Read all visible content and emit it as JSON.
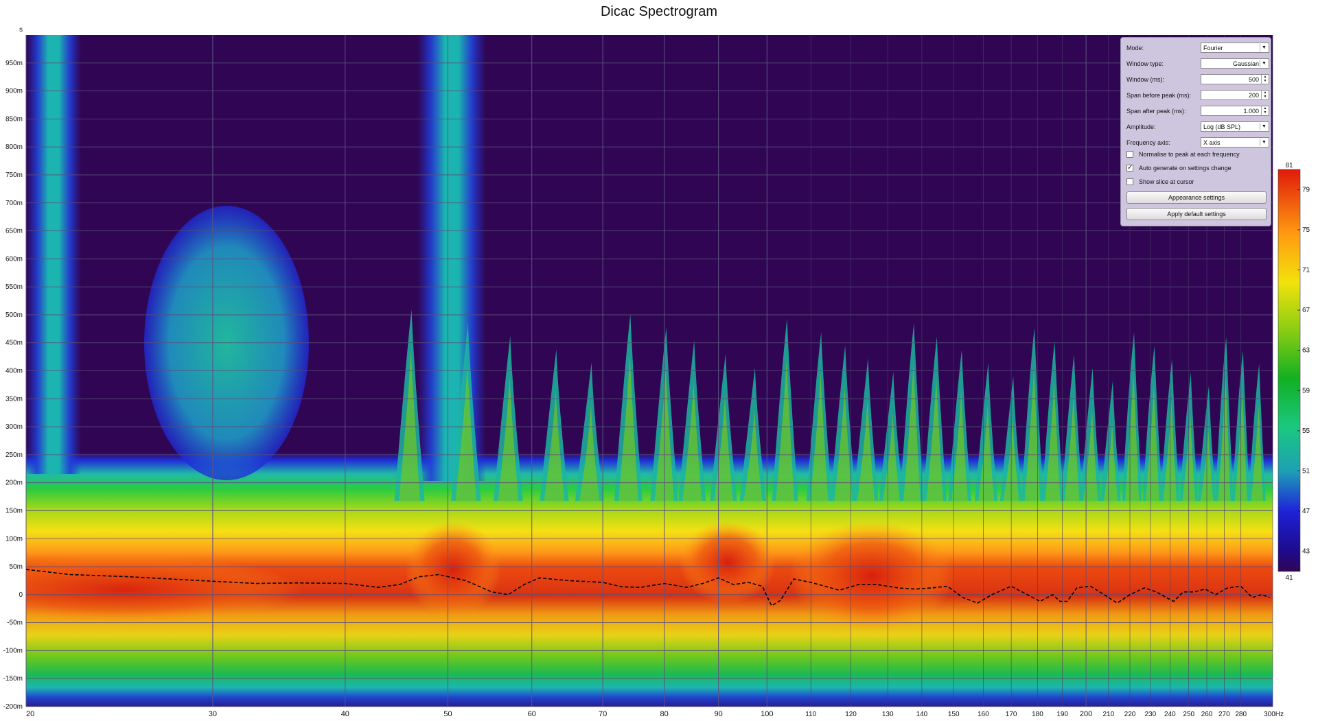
{
  "chart_data": {
    "type": "heatmap",
    "title": "Dicac Spectrogram",
    "xlabel": "Hz",
    "ylabel": "s",
    "x_scale": "log",
    "xlim": [
      20,
      300
    ],
    "ylim": [
      -0.2,
      1.0
    ],
    "x_ticks": [
      20,
      30,
      40,
      50,
      60,
      70,
      80,
      90,
      100,
      110,
      120,
      130,
      140,
      150,
      160,
      170,
      180,
      190,
      200,
      210,
      220,
      230,
      240,
      250,
      260,
      270,
      280,
      300
    ],
    "x_tick_labels": [
      "20",
      "30",
      "40",
      "50",
      "60",
      "70",
      "80",
      "90",
      "100",
      "110",
      "120",
      "130",
      "140",
      "150",
      "160",
      "170",
      "180",
      "190",
      "200",
      "210",
      "220",
      "230",
      "240",
      "250",
      "260",
      "270",
      "280",
      "300Hz"
    ],
    "x_major_ticks": [
      20,
      30,
      40,
      50,
      60,
      70,
      80,
      90,
      100,
      200
    ],
    "y_ticks": [
      0.95,
      0.9,
      0.85,
      0.8,
      0.75,
      0.7,
      0.65,
      0.6,
      0.55,
      0.5,
      0.45,
      0.4,
      0.35,
      0.3,
      0.25,
      0.2,
      0.15,
      0.1,
      0.05,
      0,
      -0.05,
      -0.1,
      -0.15,
      -0.2
    ],
    "y_tick_labels": [
      "950m",
      "900m",
      "850m",
      "800m",
      "750m",
      "700m",
      "650m",
      "600m",
      "550m",
      "500m",
      "450m",
      "400m",
      "350m",
      "300m",
      "250m",
      "200m",
      "150m",
      "100m",
      "50m",
      "0",
      "-50m",
      "-100m",
      "-150m",
      "-200m"
    ],
    "y_axis_unit": "s",
    "grid": true,
    "colorbar": {
      "min": 41,
      "max": 81,
      "ticks": [
        81,
        79,
        75,
        71,
        67,
        63,
        59,
        55,
        51,
        47,
        43,
        41
      ],
      "unit": "dB SPL"
    },
    "peak_decay_line": {
      "style": "dashed",
      "color": "#000000",
      "points": [
        [
          20,
          0.045
        ],
        [
          22,
          0.036
        ],
        [
          25,
          0.032
        ],
        [
          30,
          0.024
        ],
        [
          33,
          0.02
        ],
        [
          36,
          0.021
        ],
        [
          40,
          0.02
        ],
        [
          43,
          0.013
        ],
        [
          45,
          0.018
        ],
        [
          47,
          0.032
        ],
        [
          49,
          0.036
        ],
        [
          52,
          0.025
        ],
        [
          55,
          0.005
        ],
        [
          57,
          0.0
        ],
        [
          59,
          0.018
        ],
        [
          61,
          0.03
        ],
        [
          65,
          0.025
        ],
        [
          70,
          0.022
        ],
        [
          73,
          0.014
        ],
        [
          76,
          0.013
        ],
        [
          80,
          0.02
        ],
        [
          84,
          0.013
        ],
        [
          87,
          0.02
        ],
        [
          90,
          0.03
        ],
        [
          93,
          0.018
        ],
        [
          96,
          0.022
        ],
        [
          99,
          0.015
        ],
        [
          101,
          -0.02
        ],
        [
          103,
          -0.01
        ],
        [
          106,
          0.028
        ],
        [
          110,
          0.022
        ],
        [
          117,
          0.008
        ],
        [
          122,
          0.018
        ],
        [
          127,
          0.018
        ],
        [
          133,
          0.012
        ],
        [
          138,
          0.01
        ],
        [
          143,
          0.012
        ],
        [
          148,
          0.015
        ],
        [
          153,
          -0.005
        ],
        [
          158,
          -0.015
        ],
        [
          163,
          0.0
        ],
        [
          170,
          0.015
        ],
        [
          176,
          0.0
        ],
        [
          181,
          -0.012
        ],
        [
          186,
          0.0
        ],
        [
          189,
          -0.012
        ],
        [
          192,
          -0.012
        ],
        [
          196,
          0.012
        ],
        [
          202,
          0.015
        ],
        [
          208,
          0.0
        ],
        [
          214,
          -0.015
        ],
        [
          220,
          0.0
        ],
        [
          227,
          0.012
        ],
        [
          233,
          0.005
        ],
        [
          238,
          -0.005
        ],
        [
          242,
          -0.012
        ],
        [
          247,
          0.005
        ],
        [
          253,
          0.005
        ],
        [
          259,
          0.01
        ],
        [
          265,
          0.0
        ],
        [
          272,
          0.012
        ],
        [
          280,
          0.015
        ],
        [
          287,
          -0.005
        ],
        [
          293,
          0.0
        ],
        [
          298,
          -0.005
        ]
      ]
    }
  },
  "settings_panel": {
    "fields": [
      {
        "label": "Mode:",
        "value": "Fourier",
        "control": "dropdown",
        "align": "left"
      },
      {
        "label": "Window type:",
        "value": "Gaussian",
        "control": "dropdown",
        "align": "right"
      },
      {
        "label": "Window (ms):",
        "value": "500",
        "control": "spinner",
        "align": "right"
      },
      {
        "label": "Span before peak (ms):",
        "value": "200",
        "control": "spinner",
        "align": "right"
      },
      {
        "label": "Span after peak (ms):",
        "value": "1.000",
        "control": "spinner",
        "align": "right"
      },
      {
        "label": "Amplitude:",
        "value": "Log (dB SPL)",
        "control": "dropdown",
        "align": "left"
      },
      {
        "label": "Frequency axis:",
        "value": "X axis",
        "control": "dropdown",
        "align": "left"
      }
    ],
    "checkboxes": [
      {
        "label": "Normalise to peak at each frequency",
        "checked": false
      },
      {
        "label": "Auto generate on settings change",
        "checked": true
      },
      {
        "label": "Show slice at cursor",
        "checked": false
      }
    ],
    "buttons": {
      "appearance": "Appearance settings",
      "defaults": "Apply default settings"
    }
  }
}
